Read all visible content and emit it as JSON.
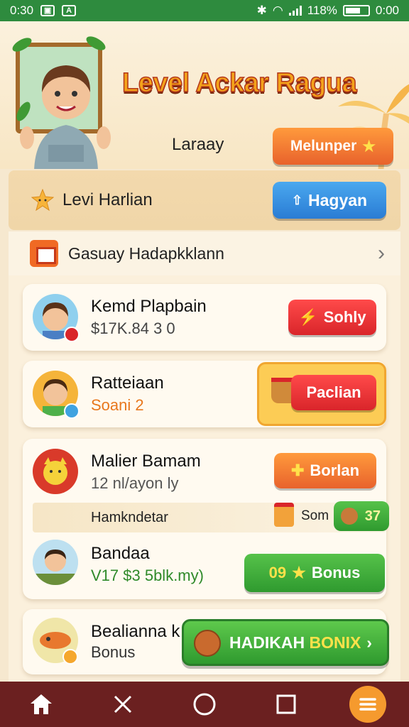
{
  "status_bar": {
    "time_left": "0:30",
    "battery": "118%",
    "time_right": "0:00"
  },
  "header": {
    "title": "Level Ackar Ragua",
    "subtitle": "Laraay",
    "button_label": "Melunper"
  },
  "daily": {
    "label": "Levi Harlian",
    "button_label": "Hagyan"
  },
  "section": {
    "label": "Gasuay Hadapkklann"
  },
  "cards": [
    {
      "name": "Kemd Plapbain",
      "sub": "$17K.84 3 0",
      "sub_color": "#444444",
      "button_label": "Sohly",
      "button_style": "red"
    },
    {
      "name": "Ratteiaan",
      "sub": "Soani 2",
      "sub_color": "#e8781e",
      "button_label": "Paclian",
      "button_style": "red"
    },
    {
      "name": "Malier Bamam",
      "sub": "12 nl/ayon ly",
      "sub_color": "#555555",
      "button_label": "Borlan",
      "button_style": "orange"
    },
    {
      "name": "Bandaa",
      "sub": "V17 $3 5blk.my)",
      "sub_color": "#2f8a2a",
      "button_label": "Bonus",
      "button_prefix": "09",
      "button_style": "green"
    },
    {
      "name": "Bealianna k",
      "sub": "Bonus",
      "sub_color": "#333333"
    }
  ],
  "sub_row": {
    "label": "Hamkndetar",
    "small_label": "Som",
    "chip_value": "37"
  },
  "bonus_button": {
    "label_a": "HADIKAH",
    "label_b": "BONIX"
  },
  "nav": [
    "home-icon",
    "close-icon",
    "circle-icon",
    "square-icon",
    "menu-icon"
  ]
}
